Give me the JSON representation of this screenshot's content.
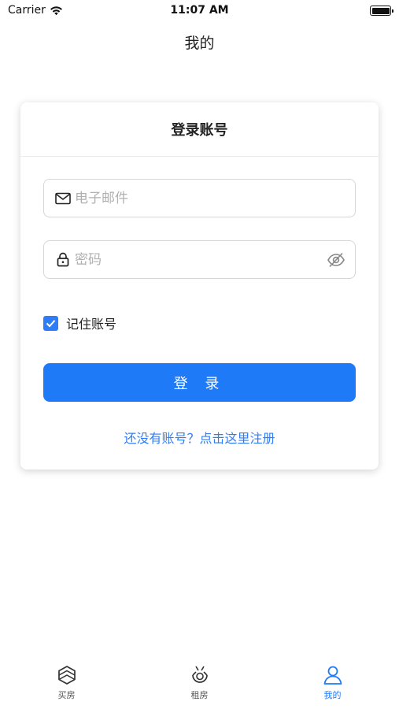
{
  "status_bar": {
    "carrier": "Carrier",
    "time": "11:07 AM"
  },
  "nav": {
    "title": "我的"
  },
  "login_card": {
    "title": "登录账号",
    "email_placeholder": "电子邮件",
    "password_placeholder": "密码",
    "remember_label": "记住账号",
    "remember_checked": true,
    "login_button": "登 录",
    "register_link": "还没有账号？点击这里注册"
  },
  "tab_bar": {
    "items": [
      {
        "label": "买房",
        "icon": "cube-icon",
        "active": false
      },
      {
        "label": "租房",
        "icon": "house-rent-icon",
        "active": false
      },
      {
        "label": "我的",
        "icon": "person-icon",
        "active": true
      }
    ]
  },
  "colors": {
    "accent": "#1f7af8",
    "link": "#2f7df6",
    "inactive_tab": "#555555"
  }
}
